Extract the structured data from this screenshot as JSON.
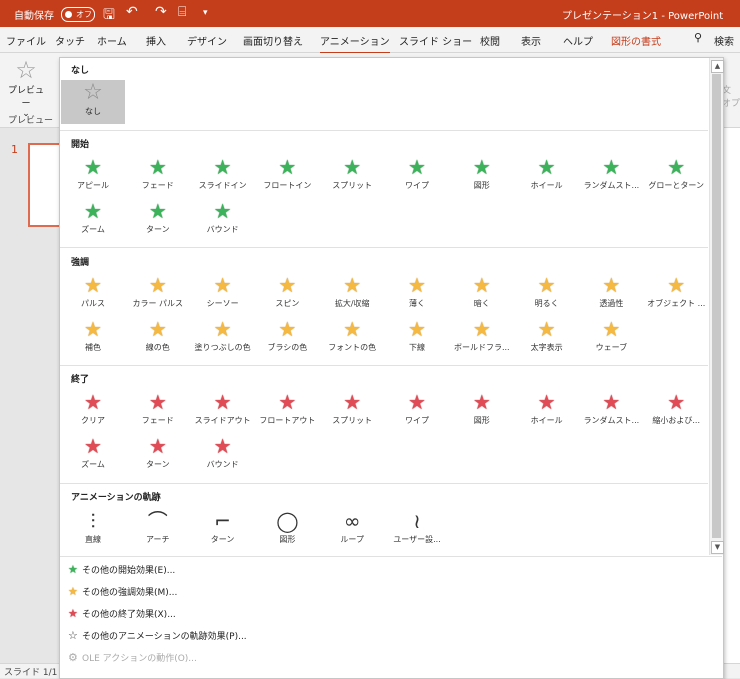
{
  "titlebar": {
    "autosave_label": "自動保存",
    "autosave_state": "オフ",
    "doc_title": "プレゼンテーション1 - PowerPoint"
  },
  "tabs": [
    "ファイル",
    "タッチ",
    "ホーム",
    "挿入",
    "デザイン",
    "画面切り替え",
    "アニメーション",
    "スライド ショー",
    "校閲",
    "表示",
    "ヘルプ",
    "図形の書式"
  ],
  "tabs_active_index": 6,
  "search_label": "検索",
  "ribbon": {
    "preview_label": "プレビュー",
    "preview_group": "プレビュー"
  },
  "slide": {
    "number": "1"
  },
  "status": {
    "slide_label": "スライド 1/1"
  },
  "gallery": {
    "none": {
      "title": "なし",
      "item_label": "なし"
    },
    "entrance": {
      "title": "開始",
      "items": [
        "アピール",
        "フェード",
        "スライドイン",
        "フロートイン",
        "スプリット",
        "ワイプ",
        "図形",
        "ホイール",
        "ランダムスト...",
        "グローとターン",
        "ズーム",
        "ターン",
        "バウンド"
      ]
    },
    "emphasis": {
      "title": "強調",
      "items": [
        "パルス",
        "カラー パルス",
        "シーソー",
        "スピン",
        "拡大/収縮",
        "薄く",
        "暗く",
        "明るく",
        "透過性",
        "オブジェクト ...",
        "補色",
        "線の色",
        "塗りつぶしの色",
        "ブラシの色",
        "フォントの色",
        "下線",
        "ボールドフラ...",
        "太字表示",
        "ウェーブ"
      ]
    },
    "exit": {
      "title": "終了",
      "items": [
        "クリア",
        "フェード",
        "スライドアウト",
        "フロートアウト",
        "スプリット",
        "ワイプ",
        "図形",
        "ホイール",
        "ランダムスト...",
        "縮小および...",
        "ズーム",
        "ターン",
        "バウンド"
      ]
    },
    "motion": {
      "title": "アニメーションの軌跡",
      "items": [
        "直線",
        "アーチ",
        "ターン",
        "図形",
        "ループ",
        "ユーザー設..."
      ]
    },
    "links": [
      {
        "label": "その他の開始効果(E)...",
        "icon": "green-star-icon",
        "disabled": false
      },
      {
        "label": "その他の強調効果(M)...",
        "icon": "yellow-star-icon",
        "disabled": false
      },
      {
        "label": "その他の終了効果(X)...",
        "icon": "red-star-icon",
        "disabled": false
      },
      {
        "label": "その他のアニメーションの軌跡効果(P)...",
        "icon": "outline-star-icon",
        "disabled": false
      },
      {
        "label": "OLE アクションの動作(O)...",
        "icon": "gear-icon",
        "disabled": true
      }
    ]
  },
  "colors": {
    "accent": "#c43e1c",
    "entrance": "#3cb35b",
    "emphasis": "#f5b941",
    "exit": "#e04b55"
  }
}
